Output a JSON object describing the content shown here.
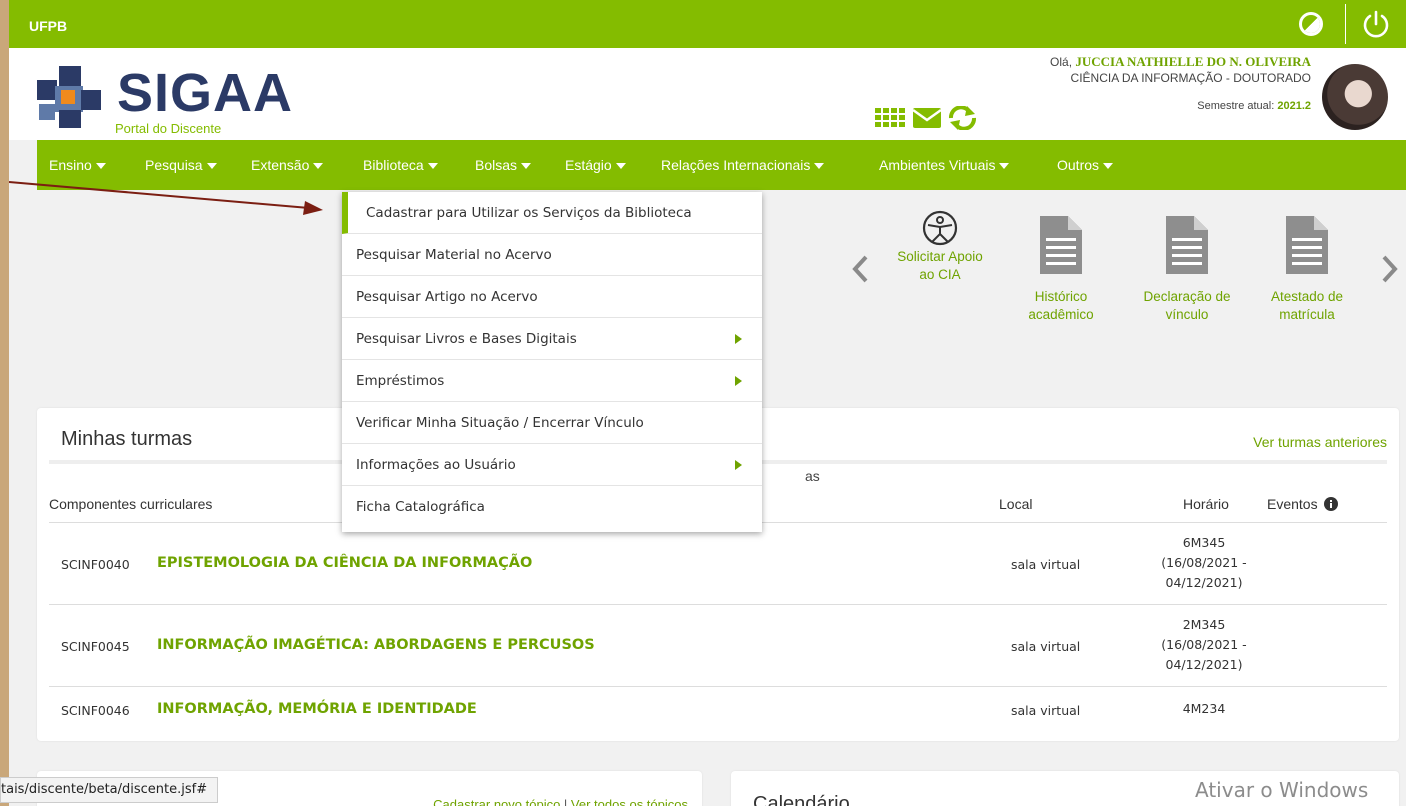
{
  "topbar": {
    "brand": "UFPB"
  },
  "header": {
    "logo_title": "SIGAA",
    "logo_subtitle": "Portal do Discente",
    "greeting_prefix": "Olá, ",
    "user_name": "JUCCIA NATHIELLE DO N. OLIVEIRA",
    "program": "CIÊNCIA DA INFORMAÇÃO - DOUTORADO",
    "semester_label": "Semestre atual: ",
    "semester_value": "2021.2"
  },
  "nav": {
    "items": [
      {
        "label": "Ensino"
      },
      {
        "label": "Pesquisa"
      },
      {
        "label": "Extensão"
      },
      {
        "label": "Biblioteca"
      },
      {
        "label": "Bolsas"
      },
      {
        "label": "Estágio"
      },
      {
        "label": "Relações Internacionais"
      },
      {
        "label": "Ambientes Virtuais"
      },
      {
        "label": "Outros"
      }
    ]
  },
  "library_menu": {
    "items": [
      {
        "label": "Cadastrar para Utilizar os Serviços da Biblioteca"
      },
      {
        "label": "Pesquisar Material no Acervo"
      },
      {
        "label": "Pesquisar Artigo no Acervo"
      },
      {
        "label": "Pesquisar Livros e Bases Digitais"
      },
      {
        "label": "Empréstimos"
      },
      {
        "label": "Verificar Minha Situação / Encerrar Vínculo"
      },
      {
        "label": "Informações ao Usuário"
      },
      {
        "label": "Ficha Catalográfica"
      }
    ]
  },
  "quick_access": {
    "items": [
      {
        "label_1": "Solicitar Apoio",
        "label_2": "ao CIA"
      },
      {
        "label_1": "Histórico",
        "label_2": "acadêmico"
      },
      {
        "label_1": "Declaração de",
        "label_2": "vínculo"
      },
      {
        "label_1": "Atestado de",
        "label_2": "matrícula"
      }
    ]
  },
  "turmas": {
    "title": "Minhas turmas",
    "previous_link": "Ver turmas anteriores",
    "partial_text": "as",
    "headers": {
      "components": "Componentes curriculares",
      "local": "Local",
      "horario": "Horário",
      "eventos": "Eventos"
    },
    "rows": [
      {
        "code": "SCINF0040",
        "name": "EPISTEMOLOGIA DA CIÊNCIA DA INFORMAÇÃO",
        "local": "sala virtual",
        "schedule_1": "6M345",
        "schedule_2": "(16/08/2021 -",
        "schedule_3": "04/12/2021)"
      },
      {
        "code": "SCINF0045",
        "name": "INFORMAÇÃO IMAGÉTICA: ABORDAGENS E PERCUSOS",
        "local": "sala virtual",
        "schedule_1": "2M345",
        "schedule_2": "(16/08/2021 -",
        "schedule_3": "04/12/2021)"
      },
      {
        "code": "SCINF0046",
        "name": "INFORMAÇÃO, MEMÓRIA E IDENTIDADE",
        "local": "sala virtual",
        "schedule_1": "4M234",
        "schedule_2": "",
        "schedule_3": ""
      }
    ]
  },
  "forum": {
    "new_topic": "Cadastrar novo tópico",
    "separator": " | ",
    "all_topics": "Ver todos os tópicos"
  },
  "calendar": {
    "title": "Calendário"
  },
  "statusbar": {
    "url": "tais/discente/beta/discente.jsf#"
  },
  "windows_watermark": "Ativar o Windows",
  "colors": {
    "brand_green": "#84bc00",
    "link_green": "#6fa300",
    "logo_navy": "#2b3a66",
    "annotation": "#7b1e12"
  }
}
